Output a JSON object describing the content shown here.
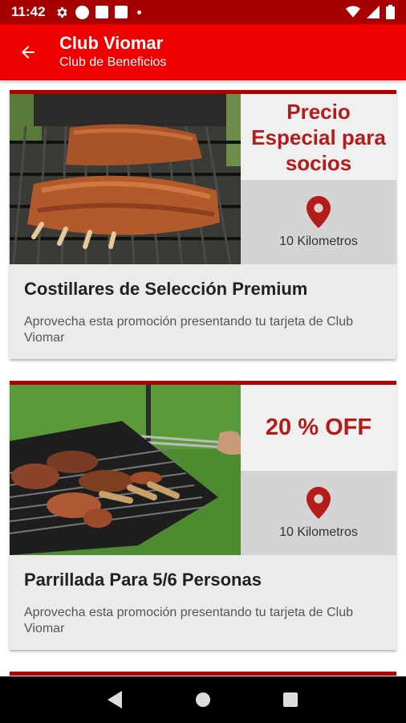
{
  "status_bar": {
    "time": "11:42",
    "left_icons": [
      "settings-icon",
      "circle-icon",
      "square-icon",
      "square-icon",
      "dot-icon"
    ],
    "right_icons": [
      "wifi-icon",
      "signal-icon",
      "battery-icon"
    ]
  },
  "app_bar": {
    "title": "Club Viomar",
    "subtitle": "Club de Beneficios",
    "back_icon": "arrow-back-icon",
    "color": "#ee0000"
  },
  "promotions": [
    {
      "price_text": "Precio Especial para socios",
      "distance": "10 Kilometros",
      "title": "Costillares de Selección Premium",
      "description": "Aprovecha esta promoción presentando tu tarjeta de Club Viomar",
      "image": "grilled-ribs-image"
    },
    {
      "price_text": "20 % OFF",
      "distance": "10 Kilometros",
      "title": "Parrillada Para 5/6 Personas",
      "description": "Aprovecha esta promoción presentando tu tarjeta de Club Viomar",
      "image": "barbecue-grill-image"
    }
  ],
  "colors": {
    "accent": "#b51b1b",
    "status_bar": "#a80000"
  },
  "nav_bar": {
    "buttons": [
      "back-triangle-icon",
      "home-circle-icon",
      "recents-square-icon"
    ]
  }
}
